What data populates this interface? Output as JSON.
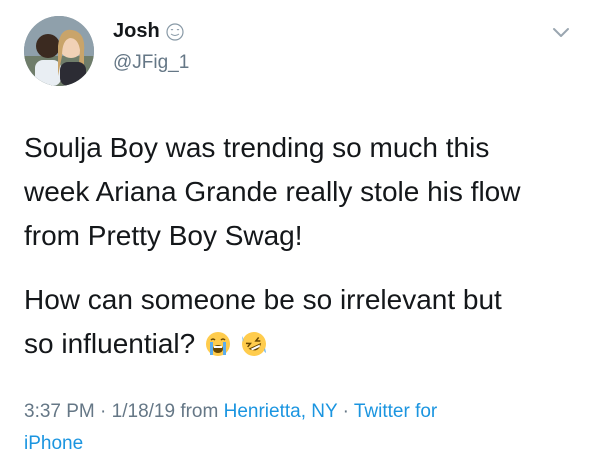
{
  "user": {
    "display_name": "Josh",
    "handle": "@JFig_1"
  },
  "tweet": {
    "line_1": "Soulja Boy was trending so much this",
    "line_2": "week Ariana Grande really stole his flow",
    "line_3": "from Pretty Boy Swag!",
    "line_4": "How can someone be so irrelevant but",
    "line_5": "so influential?",
    "emojis": [
      "crying-face-emoji",
      "rofl-emoji"
    ]
  },
  "meta": {
    "time": "3:37 PM",
    "sep_1": " · ",
    "date_prefix": "1/18/19 from ",
    "location": "Henrietta, NY",
    "sep_2": " · ",
    "source_1": "Twitter for",
    "source_2": "iPhone"
  },
  "colors": {
    "text": "#14171a",
    "muted": "#657786",
    "link": "#1b95e0"
  },
  "icons": {
    "caret": "chevron-down-icon",
    "name_badge": "smiling-face-icon"
  }
}
